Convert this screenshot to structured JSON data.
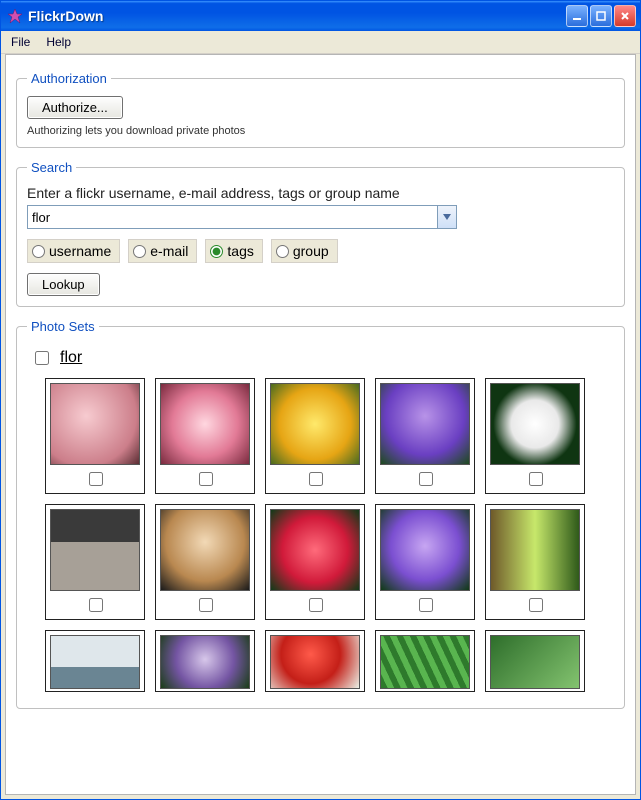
{
  "window": {
    "title": "FlickrDown"
  },
  "menu": {
    "file": "File",
    "help": "Help"
  },
  "auth": {
    "legend": "Authorization",
    "button": "Authorize...",
    "hint": "Authorizing lets you download private photos"
  },
  "search": {
    "legend": "Search",
    "instruction": "Enter a flickr username, e-mail address, tags or group name",
    "value": "flor",
    "radios": {
      "username": "username",
      "email": "e-mail",
      "tags": "tags",
      "group": "group",
      "selected": "tags"
    },
    "lookup": "Lookup"
  },
  "photosets": {
    "legend": "Photo Sets",
    "set_name": "flor"
  }
}
